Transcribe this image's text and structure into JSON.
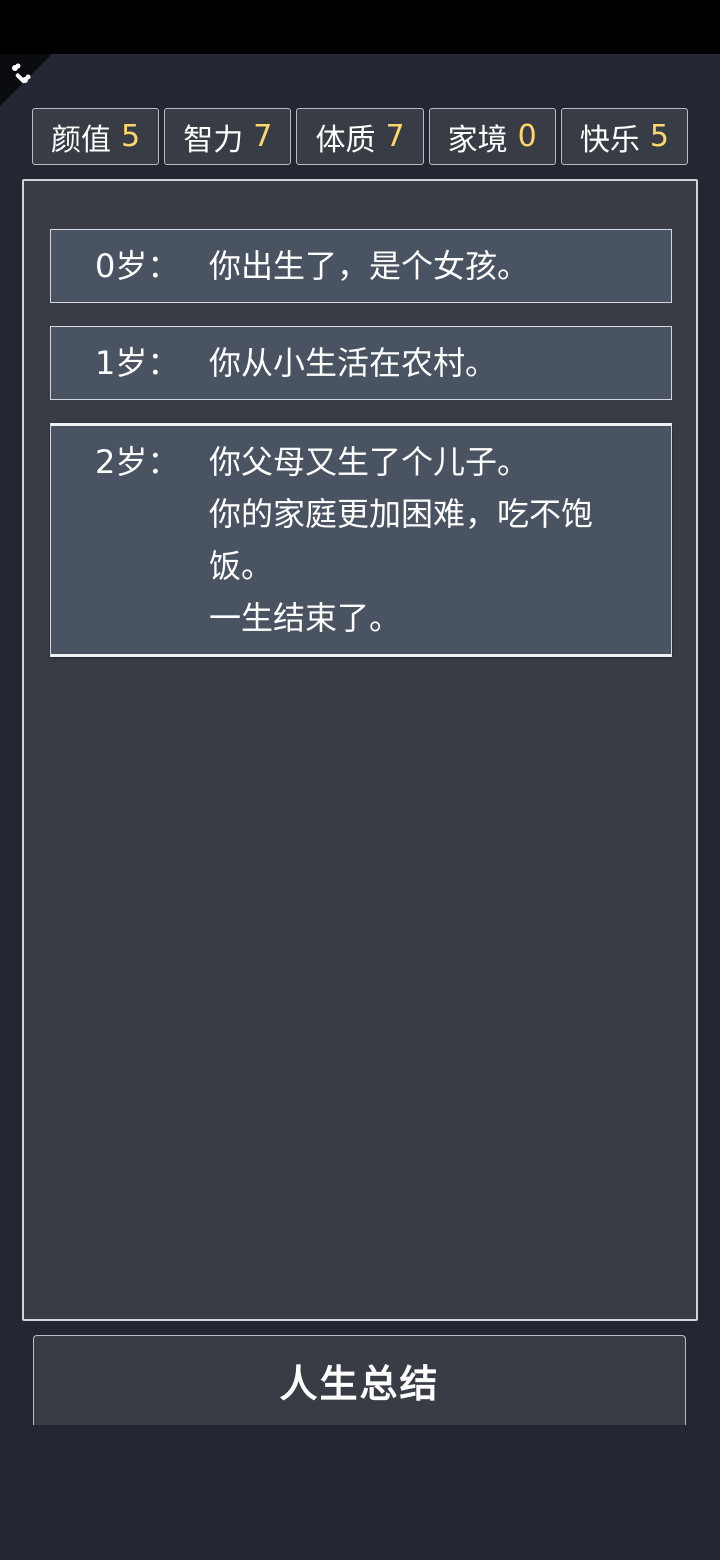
{
  "stats": [
    {
      "label": "颜值",
      "value": "5"
    },
    {
      "label": "智力",
      "value": "7"
    },
    {
      "label": "体质",
      "value": "7"
    },
    {
      "label": "家境",
      "value": "0"
    },
    {
      "label": "快乐",
      "value": "5"
    }
  ],
  "log": [
    {
      "age": "0岁：",
      "lines": [
        "你出生了，是个女孩。"
      ]
    },
    {
      "age": "1岁：",
      "lines": [
        "你从小生活在农村。"
      ]
    },
    {
      "age": "2岁：",
      "lines": [
        "你父母又生了个儿子。",
        "你的家庭更加困难，吃不饱",
        "饭。",
        "一生结束了。"
      ]
    }
  ],
  "summary_button": {
    "label": "人生总结"
  },
  "colors": {
    "accent_value": "#ffd66b",
    "panel": "#393c45",
    "entry": "#4a5361",
    "background": "#232731"
  },
  "icons": {
    "corner": "bone-icon"
  }
}
